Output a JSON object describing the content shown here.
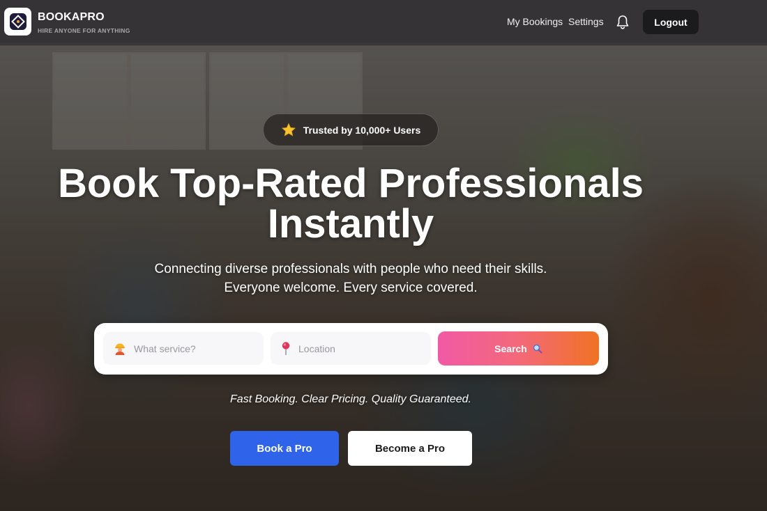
{
  "header": {
    "brand_name": "BOOKAPRO",
    "brand_tagline": "HIRE ANYONE FOR ANYTHING",
    "nav": [
      "My Bookings",
      "Settings"
    ],
    "logout_label": "Logout"
  },
  "hero": {
    "trust_badge": "Trusted by 10,000+ Users",
    "headline_line1": "Book Top-Rated Professionals",
    "headline_line2": "Instantly",
    "subtext_line1": "Connecting diverse professionals with people who need their skills.",
    "subtext_line2": "Everyone welcome. Every service covered.",
    "tagline": "Fast Booking. Clear Pricing. Quality Guaranteed."
  },
  "search": {
    "service_placeholder": "What service?",
    "service_icon": "worker-icon",
    "location_placeholder": "Location",
    "location_icon": "pin-icon",
    "button_label": "Search",
    "button_icon": "magnifier-icon"
  },
  "cta": {
    "primary_label": "Book a Pro",
    "secondary_label": "Become a Pro"
  },
  "colors": {
    "header_bg": "#353335",
    "primary_blue": "#2f63ea",
    "search_gradient_start": "#f15aa5",
    "search_gradient_end": "#f07224"
  }
}
